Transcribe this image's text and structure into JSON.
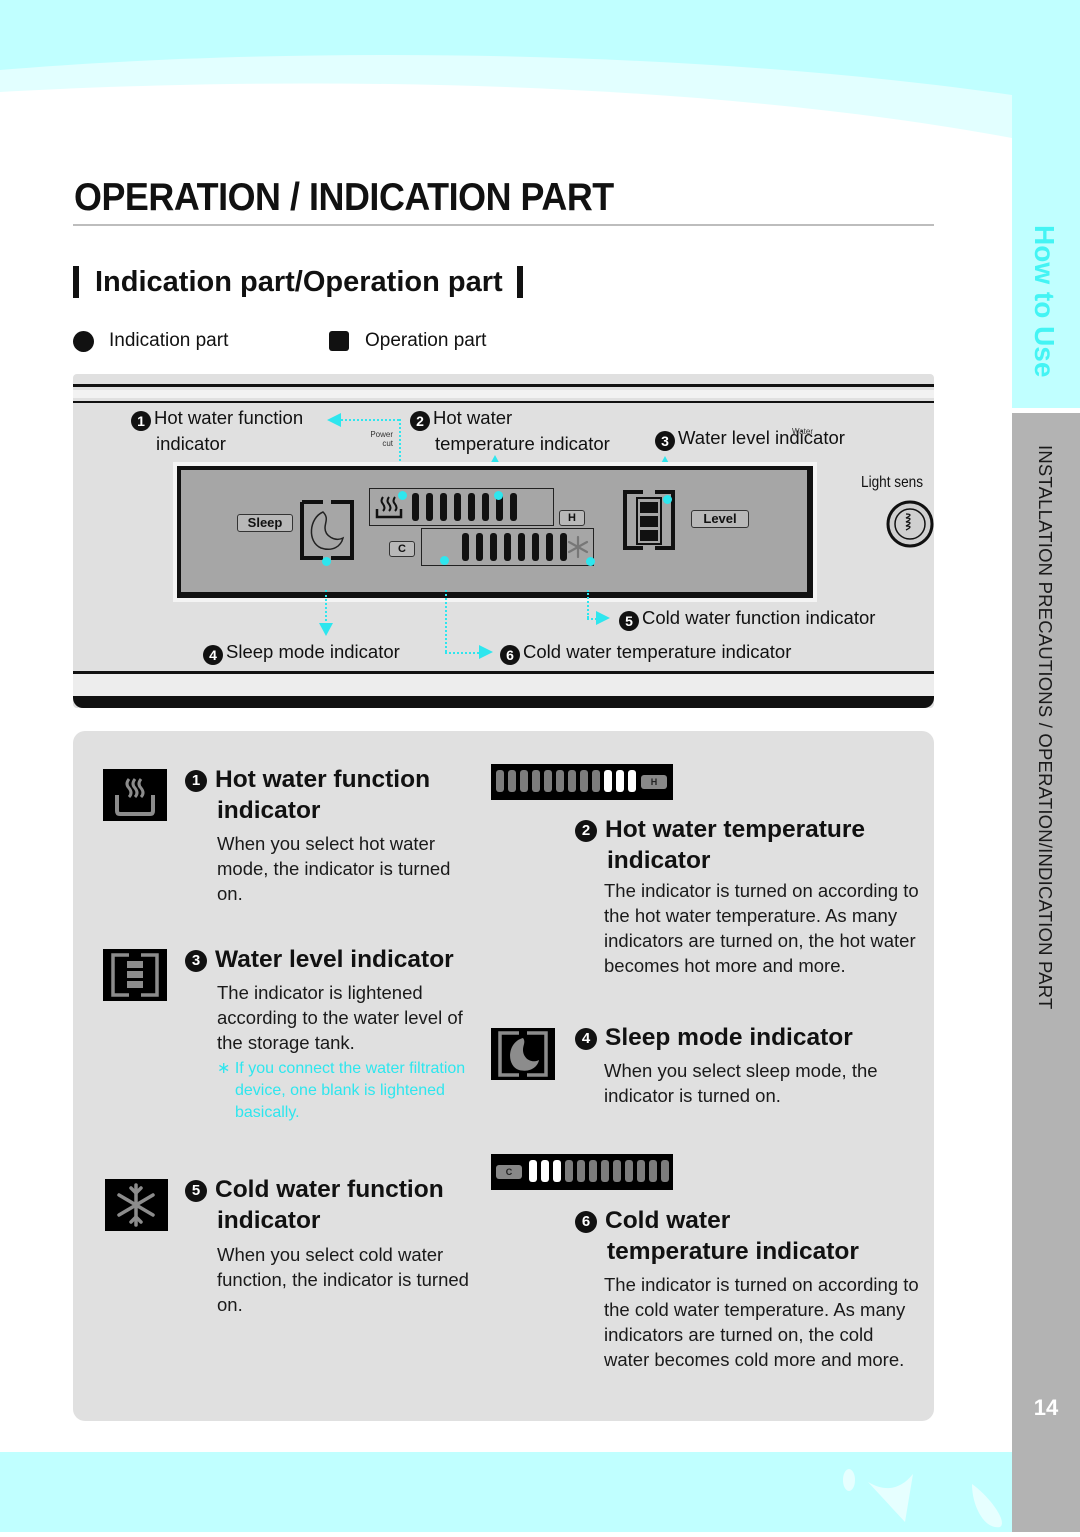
{
  "page": {
    "title": "OPERATION / INDICATION PART",
    "subtitle": "Indication part/Operation part",
    "page_number": "14",
    "colors": {
      "accent_cyan": "#2ee6ee",
      "band_cyan": "#c0ffff",
      "panel_gray": "#e0e0e0",
      "side_tab_gray": "#b3b3b3"
    }
  },
  "side_tab": {
    "section_label": "How to Use",
    "chapter_label": "INSTALLATION PRECAUTIONS / OPERATION/INDICATION PART"
  },
  "legend": {
    "indication": {
      "icon": "circle-icon",
      "label": "Indication part"
    },
    "operation": {
      "icon": "square-icon",
      "label": "Operation part"
    }
  },
  "diagram": {
    "callouts": {
      "c1_num": "1",
      "c1_line1": "Hot water function",
      "c1_line2": "indicator",
      "c2_num": "2",
      "c2_line1": "Hot water",
      "c2_line2": "temperature indicator",
      "c3_num": "3",
      "c3_text": "Water level indicator",
      "c4_num": "4",
      "c4_text": "Sleep mode indicator",
      "c5_num": "5",
      "c5_text": "Cold water function indicator",
      "c6_num": "6",
      "c6_text": "Cold water temperature indicator"
    },
    "power_cut_line1": "Power",
    "power_cut_line2": "cut",
    "water_small_text": "Water",
    "light_sensor_label": "Light sens",
    "panel_labels": {
      "sleep": "Sleep",
      "hot": "H",
      "cold": "C",
      "level": "Level"
    },
    "hot_segments_lit": 8,
    "cold_segments_lit": 8,
    "level_blocks_lit": 3
  },
  "descriptions": {
    "d1": {
      "num": "1",
      "title_line1": "Hot water function",
      "title_line2": "indicator",
      "icon": "hot-water-steam-icon",
      "body": "When you select hot water mode, the indicator is turned on."
    },
    "d2": {
      "num": "2",
      "title_line1": "Hot water temperature",
      "title_line2": "indicator",
      "strip_tag": "H",
      "segments_total": 12,
      "segments_on": 3,
      "body": "The indicator is turned on according to the hot water temperature. As many indicators are turned on, the hot water becomes hot more and more."
    },
    "d3": {
      "num": "3",
      "title": "Water level indicator",
      "icon": "water-level-icon",
      "body": "The indicator is lightened according to the water level of the storage tank.",
      "note": "∗ If you connect the water filtration device, one blank is lightened basically."
    },
    "d4": {
      "num": "4",
      "title": "Sleep mode indicator",
      "icon": "moon-icon",
      "body": "When you select sleep mode, the indicator is turned on."
    },
    "d5": {
      "num": "5",
      "title_line1": "Cold water function",
      "title_line2": "indicator",
      "icon": "snowflake-icon",
      "body": "When you select cold water function, the indicator is turned on."
    },
    "d6": {
      "num": "6",
      "title_line1": "Cold water",
      "title_line2": "temperature indicator",
      "strip_tag": "C",
      "segments_total": 12,
      "segments_on": 3,
      "body": "The indicator is turned on according to the cold water temperature. As many indicators are turned on, the cold water becomes cold more and more."
    }
  }
}
